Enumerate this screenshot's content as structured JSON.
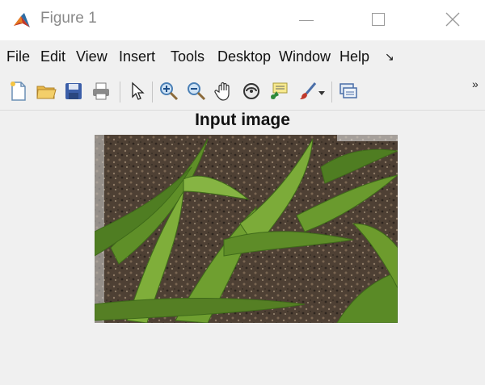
{
  "window": {
    "title": "Figure 1",
    "app_icon": "matlab-icon"
  },
  "menu": {
    "items": [
      "File",
      "Edit",
      "View",
      "Insert",
      "Tools",
      "Desktop",
      "Window",
      "Help"
    ],
    "overflow_icon": "menu-overflow-arrow-icon"
  },
  "toolbar": {
    "buttons": [
      "new-figure-icon",
      "open-file-icon",
      "save-icon",
      "print-icon",
      "pointer-icon",
      "zoom-in-icon",
      "zoom-out-icon",
      "pan-hand-icon",
      "rotate-3d-icon",
      "data-cursor-icon",
      "brush-icon",
      "brush-dropdown-icon",
      "link-plot-icon",
      "toolbar-overflow-icon"
    ],
    "overflow_label": "»"
  },
  "figure": {
    "axes_title": "Input image",
    "image_description_icon": "plant-seedlings-photo"
  },
  "colors": {
    "background": "#f0f0f0",
    "titlebar": "#ffffff",
    "soil": "#5a4a3a",
    "leaf": "#6e9e2e"
  }
}
